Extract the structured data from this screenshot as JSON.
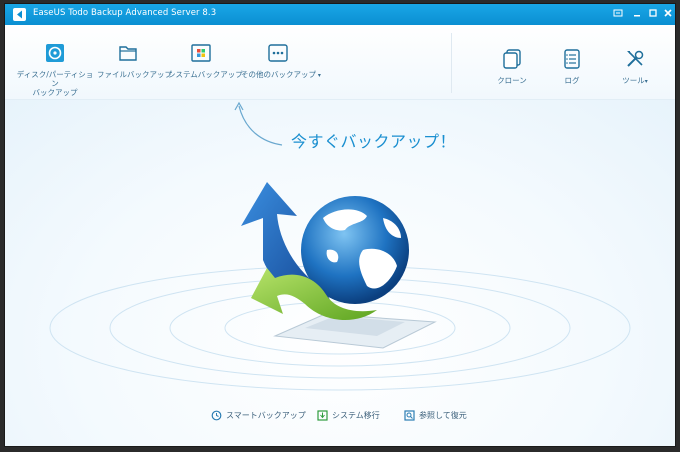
{
  "window": {
    "title": "EaseUS Todo Backup Advanced Server 8.3"
  },
  "toolbar": {
    "left": [
      {
        "label": "ディスク/パーティション\nバックアップ",
        "icon": "disk-backup-icon"
      },
      {
        "label": "ファイルバックアップ",
        "icon": "folder-icon"
      },
      {
        "label": "システムバックアップ",
        "icon": "windows-icon"
      },
      {
        "label": "その他のバックアップ",
        "icon": "more-icon"
      }
    ],
    "right": [
      {
        "label": "クローン",
        "icon": "clone-icon"
      },
      {
        "label": "ログ",
        "icon": "log-icon"
      },
      {
        "label": "ツール",
        "icon": "tools-icon"
      }
    ]
  },
  "main": {
    "hint": "今すぐバックアップ！",
    "bottom": [
      {
        "label": "スマートバックアップ",
        "icon": "smart-backup-icon"
      },
      {
        "label": "システム移行",
        "icon": "system-migration-icon"
      },
      {
        "label": "参照して復元",
        "icon": "browse-restore-icon"
      }
    ]
  },
  "colors": {
    "accent": "#1a8fd0",
    "titlebar": "#0b8fd2",
    "text": "#3a6f92"
  }
}
